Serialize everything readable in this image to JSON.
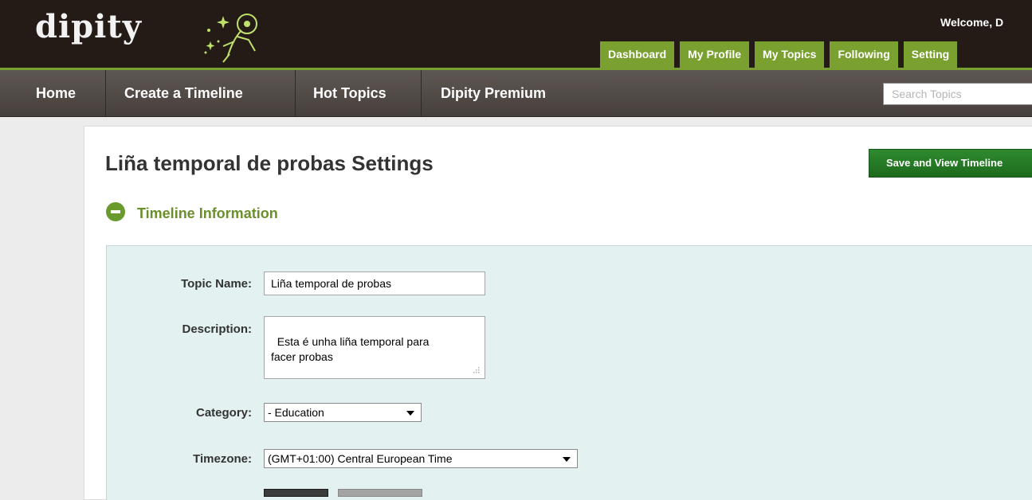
{
  "header": {
    "logo_text": "dipity",
    "welcome_text": "Welcome, D",
    "user_tabs": [
      "Dashboard",
      "My Profile",
      "My Topics",
      "Following",
      "Setting"
    ]
  },
  "nav": {
    "items": [
      "Home",
      "Create a Timeline",
      "Hot Topics",
      "Dipity Premium"
    ],
    "search_placeholder": "Search Topics"
  },
  "page": {
    "title": "Liña temporal de probas Settings",
    "save_button": "Save and View Timeline"
  },
  "section": {
    "title": "Timeline Information"
  },
  "form": {
    "topic_name_label": "Topic Name:",
    "topic_name_value": "Liña temporal de probas",
    "description_label": "Description:",
    "description_value": "Esta é unha liña temporal para\nfacer probas",
    "category_label": "Category:",
    "category_value": "- Education",
    "timezone_label": "Timezone:",
    "timezone_value": "(GMT+01:00) Central European Time"
  },
  "colors": {
    "header_bg": "#241b17",
    "accent_green": "#7aa02f",
    "nav_bg": "#4f4843",
    "save_button_bg": "#2a7d2a",
    "form_bg": "#e3f1f1"
  },
  "icons": {
    "logo_mascot": "spaceman-icon",
    "section_toggle": "collapse-minus-icon",
    "dropdown": "chevron-down-icon",
    "resize": "resize-grip-icon"
  }
}
